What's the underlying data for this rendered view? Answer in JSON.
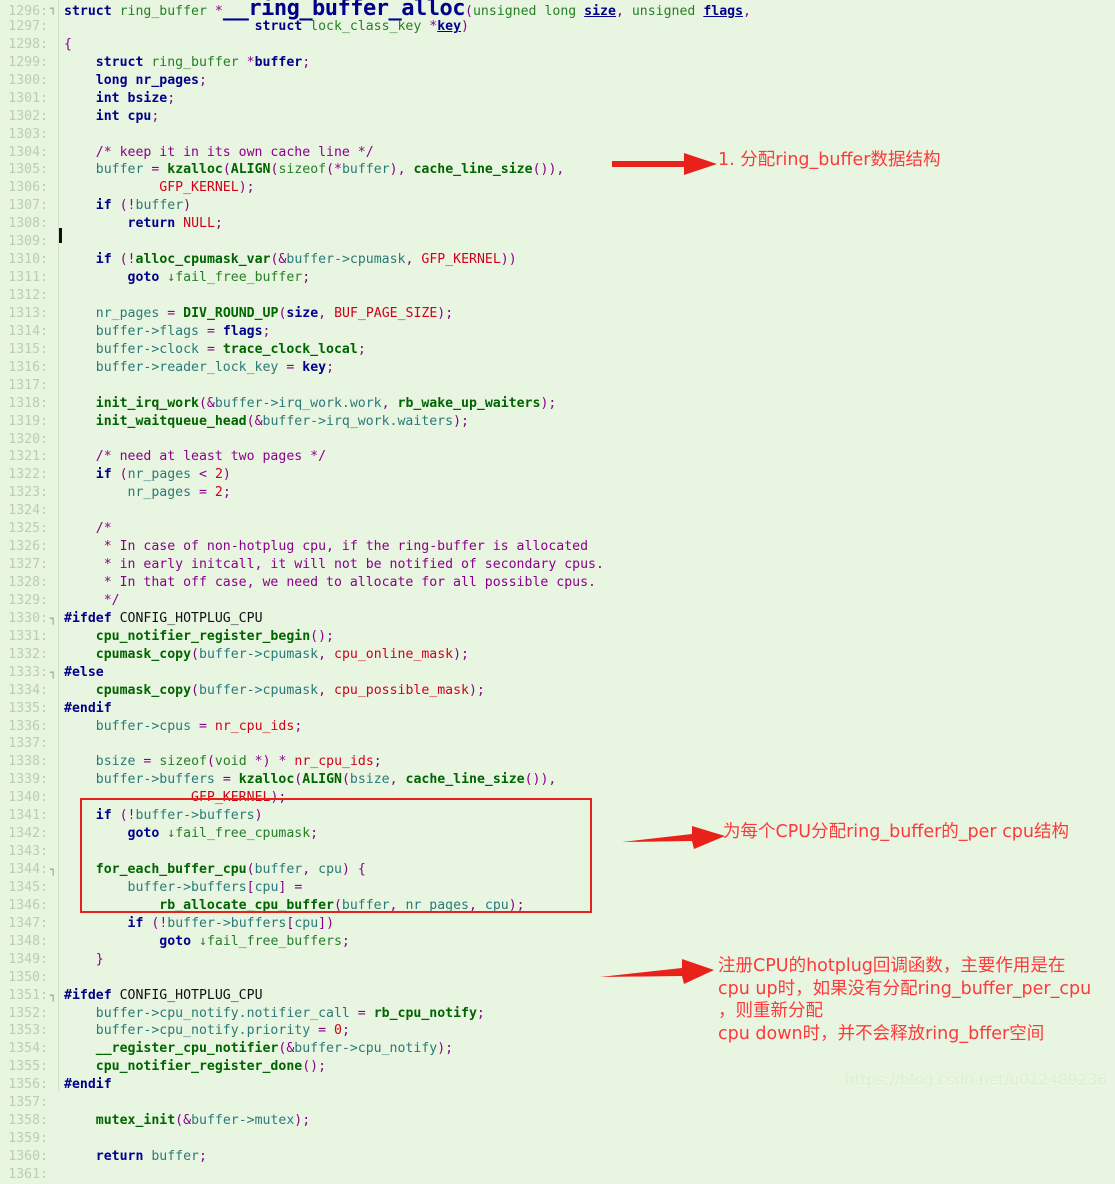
{
  "editor": {
    "background_color": "#e8f5e0",
    "gutter_color": "#b9cfb0",
    "first_line": 1296,
    "last_line": 1361,
    "cursor_line": 1309
  },
  "lines": [
    {
      "n": "1296",
      "fold": "-",
      "html": "<span class=\"kw\">struct</span> <span class=\"type\">ring_buffer</span> <span class=\"punc\">*</span><span class=\"big\">__ring_buffer_alloc</span><span class=\"punc\">(</span><span class=\"type\">unsigned</span> <span class=\"type\">long</span> <span class=\"varb ulin\">size</span><span class=\"punc\">,</span> <span class=\"type\">unsigned</span> <span class=\"varb ulin\">flags</span><span class=\"punc\">,</span>"
    },
    {
      "n": "1297",
      "fold": "",
      "html": "                        <span class=\"kw\">struct</span> <span class=\"type\">lock_class_key</span> <span class=\"punc\">*</span><span class=\"varb ulin\">key</span><span class=\"punc\">)</span>"
    },
    {
      "n": "1298",
      "fold": "",
      "html": "<span class=\"punc\">{</span>"
    },
    {
      "n": "1299",
      "fold": "",
      "html": "    <span class=\"kw\">struct</span> <span class=\"type\">ring_buffer</span> <span class=\"punc\">*</span><span class=\"varb\">buffer</span><span class=\"punc\">;</span>"
    },
    {
      "n": "1300",
      "fold": "",
      "html": "    <span class=\"kw\">long</span> <span class=\"varb\">nr_pages</span><span class=\"punc\">;</span>"
    },
    {
      "n": "1301",
      "fold": "",
      "html": "    <span class=\"kw\">int</span> <span class=\"varb\">bsize</span><span class=\"punc\">;</span>"
    },
    {
      "n": "1302",
      "fold": "",
      "html": "    <span class=\"kw\">int</span> <span class=\"varb\">cpu</span><span class=\"punc\">;</span>"
    },
    {
      "n": "1303",
      "fold": "",
      "html": ""
    },
    {
      "n": "1304",
      "fold": "",
      "html": "    <span class=\"cmt\">/* keep it in its own cache line */</span>"
    },
    {
      "n": "1305",
      "fold": "",
      "html": "    <span class=\"var\">buffer</span> <span class=\"punc\">=</span> <span class=\"fn\">kzalloc</span><span class=\"punc\">(</span><span class=\"fn\">ALIGN</span><span class=\"punc\">(</span><span class=\"type\">sizeof</span><span class=\"punc\">(*</span><span class=\"var\">buffer</span><span class=\"punc\">),</span> <span class=\"fn\">cache_line_size</span><span class=\"punc\">()),</span>"
    },
    {
      "n": "1306",
      "fold": "",
      "html": "            <span class=\"macro\">GFP_KERNEL</span><span class=\"punc\">);</span>"
    },
    {
      "n": "1307",
      "fold": "",
      "html": "    <span class=\"kw\">if</span> <span class=\"punc\">(!</span><span class=\"var\">buffer</span><span class=\"punc\">)</span>"
    },
    {
      "n": "1308",
      "fold": "",
      "html": "        <span class=\"kw\">return</span> <span class=\"macro\">NULL</span><span class=\"punc\">;</span>"
    },
    {
      "n": "1309",
      "fold": "",
      "html": ""
    },
    {
      "n": "1310",
      "fold": "",
      "html": "    <span class=\"kw\">if</span> <span class=\"punc\">(!</span><span class=\"fn\">alloc_cpumask_var</span><span class=\"punc\">(&amp;</span><span class=\"var\">buffer-&gt;cpumask</span><span class=\"punc\">,</span> <span class=\"macro\">GFP_KERNEL</span><span class=\"punc\">))</span>"
    },
    {
      "n": "1311",
      "fold": "",
      "html": "        <span class=\"kw\">goto</span> <span class=\"type\">&#8595;fail_free_buffer</span><span class=\"punc\">;</span>"
    },
    {
      "n": "1312",
      "fold": "",
      "html": ""
    },
    {
      "n": "1313",
      "fold": "",
      "html": "    <span class=\"var\">nr_pages</span> <span class=\"punc\">=</span> <span class=\"fn\">DIV_ROUND_UP</span><span class=\"punc\">(</span><span class=\"varb\">size</span><span class=\"punc\">,</span> <span class=\"macro\">BUF_PAGE_SIZE</span><span class=\"punc\">);</span>"
    },
    {
      "n": "1314",
      "fold": "",
      "html": "    <span class=\"var\">buffer-&gt;flags</span> <span class=\"punc\">=</span> <span class=\"varb\">flags</span><span class=\"punc\">;</span>"
    },
    {
      "n": "1315",
      "fold": "",
      "html": "    <span class=\"var\">buffer-&gt;clock</span> <span class=\"punc\">=</span> <span class=\"fn\">trace_clock_local</span><span class=\"punc\">;</span>"
    },
    {
      "n": "1316",
      "fold": "",
      "html": "    <span class=\"var\">buffer-&gt;reader_lock_key</span> <span class=\"punc\">=</span> <span class=\"varb\">key</span><span class=\"punc\">;</span>"
    },
    {
      "n": "1317",
      "fold": "",
      "html": ""
    },
    {
      "n": "1318",
      "fold": "",
      "html": "    <span class=\"fn\">init_irq_work</span><span class=\"punc\">(&amp;</span><span class=\"var\">buffer-&gt;irq_work.work</span><span class=\"punc\">,</span> <span class=\"fn\">rb_wake_up_waiters</span><span class=\"punc\">);</span>"
    },
    {
      "n": "1319",
      "fold": "",
      "html": "    <span class=\"fn\">init_waitqueue_head</span><span class=\"punc\">(&amp;</span><span class=\"var\">buffer-&gt;irq_work.waiters</span><span class=\"punc\">);</span>"
    },
    {
      "n": "1320",
      "fold": "",
      "html": ""
    },
    {
      "n": "1321",
      "fold": "",
      "html": "    <span class=\"cmt\">/* need at least two pages */</span>"
    },
    {
      "n": "1322",
      "fold": "",
      "html": "    <span class=\"kw\">if</span> <span class=\"punc\">(</span><span class=\"var\">nr_pages</span> <span class=\"punc\">&lt;</span> <span class=\"num\">2</span><span class=\"punc\">)</span>"
    },
    {
      "n": "1323",
      "fold": "",
      "html": "        <span class=\"var\">nr_pages</span> <span class=\"punc\">=</span> <span class=\"num\">2</span><span class=\"punc\">;</span>"
    },
    {
      "n": "1324",
      "fold": "",
      "html": ""
    },
    {
      "n": "1325",
      "fold": "",
      "html": "    <span class=\"cmt\">/*</span>"
    },
    {
      "n": "1326",
      "fold": "",
      "html": "     <span class=\"cmt\">* In case of non-hotplug cpu, if the ring-buffer is allocated</span>"
    },
    {
      "n": "1327",
      "fold": "",
      "html": "     <span class=\"cmt\">* in early initcall, it will not be notified of secondary cpus.</span>"
    },
    {
      "n": "1328",
      "fold": "",
      "html": "     <span class=\"cmt\">* In that off case, we need to allocate for all possible cpus.</span>"
    },
    {
      "n": "1329",
      "fold": "",
      "html": "     <span class=\"cmt\">*/</span>"
    },
    {
      "n": "1330",
      "fold": "-",
      "html": "<span class=\"pre\">#ifdef</span> <span class=\"preid\">CONFIG_HOTPLUG_CPU</span>"
    },
    {
      "n": "1331",
      "fold": "",
      "html": "    <span class=\"fn\">cpu_notifier_register_begin</span><span class=\"punc\">();</span>"
    },
    {
      "n": "1332",
      "fold": "",
      "html": "    <span class=\"fn\">cpumask_copy</span><span class=\"punc\">(</span><span class=\"var\">buffer-&gt;cpumask</span><span class=\"punc\">,</span> <span class=\"macro\">cpu_online_mask</span><span class=\"punc\">);</span>"
    },
    {
      "n": "1333",
      "fold": "-",
      "html": "<span class=\"pre\">#else</span>"
    },
    {
      "n": "1334",
      "fold": "",
      "html": "    <span class=\"fn\">cpumask_copy</span><span class=\"punc\">(</span><span class=\"var\">buffer-&gt;cpumask</span><span class=\"punc\">,</span> <span class=\"macro\">cpu_possible_mask</span><span class=\"punc\">);</span>"
    },
    {
      "n": "1335",
      "fold": "",
      "html": "<span class=\"pre\">#endif</span>"
    },
    {
      "n": "1336",
      "fold": "",
      "html": "    <span class=\"var\">buffer-&gt;cpus</span> <span class=\"punc\">=</span> <span class=\"macro\">nr_cpu_ids</span><span class=\"punc\">;</span>"
    },
    {
      "n": "1337",
      "fold": "",
      "html": ""
    },
    {
      "n": "1338",
      "fold": "",
      "html": "    <span class=\"var\">bsize</span> <span class=\"punc\">=</span> <span class=\"type\">sizeof</span><span class=\"punc\">(</span><span class=\"type\">void</span> <span class=\"punc\">*)</span> <span class=\"punc\">*</span> <span class=\"macro\">nr_cpu_ids</span><span class=\"punc\">;</span>"
    },
    {
      "n": "1339",
      "fold": "",
      "html": "    <span class=\"var\">buffer-&gt;buffers</span> <span class=\"punc\">=</span> <span class=\"fn\">kzalloc</span><span class=\"punc\">(</span><span class=\"fn\">ALIGN</span><span class=\"punc\">(</span><span class=\"var\">bsize</span><span class=\"punc\">,</span> <span class=\"fn\">cache_line_size</span><span class=\"punc\">()),</span>"
    },
    {
      "n": "1340",
      "fold": "",
      "html": "                <span class=\"macro\">GFP_KERNEL</span><span class=\"punc\">);</span>"
    },
    {
      "n": "1341",
      "fold": "",
      "html": "    <span class=\"kw\">if</span> <span class=\"punc\">(!</span><span class=\"var\">buffer-&gt;buffers</span><span class=\"punc\">)</span>"
    },
    {
      "n": "1342",
      "fold": "",
      "html": "        <span class=\"kw\">goto</span> <span class=\"type\">&#8595;fail_free_cpumask</span><span class=\"punc\">;</span>"
    },
    {
      "n": "1343",
      "fold": "",
      "html": ""
    },
    {
      "n": "1344",
      "fold": "-",
      "html": "    <span class=\"fn\">for_each_buffer_cpu</span><span class=\"punc\">(</span><span class=\"var\">buffer</span><span class=\"punc\">,</span> <span class=\"var\">cpu</span><span class=\"punc\">)</span> <span class=\"punc\">{</span>"
    },
    {
      "n": "1345",
      "fold": "",
      "html": "        <span class=\"var\">buffer-&gt;buffers</span><span class=\"punc\">[</span><span class=\"var\">cpu</span><span class=\"punc\">]</span> <span class=\"punc\">=</span>"
    },
    {
      "n": "1346",
      "fold": "",
      "html": "            <span class=\"fn\">rb_allocate_cpu_buffer</span><span class=\"punc\">(</span><span class=\"var\">buffer</span><span class=\"punc\">,</span> <span class=\"var\">nr_pages</span><span class=\"punc\">,</span> <span class=\"var\">cpu</span><span class=\"punc\">);</span>"
    },
    {
      "n": "1347",
      "fold": "",
      "html": "        <span class=\"kw\">if</span> <span class=\"punc\">(!</span><span class=\"var\">buffer-&gt;buffers</span><span class=\"punc\">[</span><span class=\"var\">cpu</span><span class=\"punc\">])</span>"
    },
    {
      "n": "1348",
      "fold": "",
      "html": "            <span class=\"kw\">goto</span> <span class=\"type\">&#8595;fail_free_buffers</span><span class=\"punc\">;</span>"
    },
    {
      "n": "1349",
      "fold": "",
      "html": "    <span class=\"punc\">}</span>"
    },
    {
      "n": "1350",
      "fold": "",
      "html": ""
    },
    {
      "n": "1351",
      "fold": "-",
      "html": "<span class=\"pre\">#ifdef</span> <span class=\"preid\">CONFIG_HOTPLUG_CPU</span>"
    },
    {
      "n": "1352",
      "fold": "",
      "html": "    <span class=\"var\">buffer-&gt;cpu_notify.notifier_call</span> <span class=\"punc\">=</span> <span class=\"fn\">rb_cpu_notify</span><span class=\"punc\">;</span>"
    },
    {
      "n": "1353",
      "fold": "",
      "html": "    <span class=\"var\">buffer-&gt;cpu_notify.priority</span> <span class=\"punc\">=</span> <span class=\"num\">0</span><span class=\"punc\">;</span>"
    },
    {
      "n": "1354",
      "fold": "",
      "html": "    <span class=\"fn\">__register_cpu_notifier</span><span class=\"punc\">(&amp;</span><span class=\"var\">buffer-&gt;cpu_notify</span><span class=\"punc\">);</span>"
    },
    {
      "n": "1355",
      "fold": "",
      "html": "    <span class=\"fn\">cpu_notifier_register_done</span><span class=\"punc\">();</span>"
    },
    {
      "n": "1356",
      "fold": "",
      "html": "<span class=\"pre\">#endif</span>"
    },
    {
      "n": "1357",
      "fold": "",
      "html": ""
    },
    {
      "n": "1358",
      "fold": "",
      "html": "    <span class=\"fn\">mutex_init</span><span class=\"punc\">(&amp;</span><span class=\"var\">buffer-&gt;mutex</span><span class=\"punc\">);</span>"
    },
    {
      "n": "1359",
      "fold": "",
      "html": ""
    },
    {
      "n": "1360",
      "fold": "",
      "html": "    <span class=\"kw\">return</span> <span class=\"var\">buffer</span><span class=\"punc\">;</span>"
    },
    {
      "n": "1361",
      "fold": "",
      "html": ""
    }
  ],
  "code_plaintext": [
    "struct ring_buffer *__ring_buffer_alloc(unsigned long size, unsigned flags,",
    "                        struct lock_class_key *key)",
    "{",
    "    struct ring_buffer *buffer;",
    "    long nr_pages;",
    "    int bsize;",
    "    int cpu;",
    "",
    "    /* keep it in its own cache line */",
    "    buffer = kzalloc(ALIGN(sizeof(*buffer), cache_line_size()),",
    "            GFP_KERNEL);",
    "    if (!buffer)",
    "        return NULL;",
    "",
    "    if (!alloc_cpumask_var(&buffer->cpumask, GFP_KERNEL))",
    "        goto fail_free_buffer;",
    "",
    "    nr_pages = DIV_ROUND_UP(size, BUF_PAGE_SIZE);",
    "    buffer->flags = flags;",
    "    buffer->clock = trace_clock_local;",
    "    buffer->reader_lock_key = key;",
    "",
    "    init_irq_work(&buffer->irq_work.work, rb_wake_up_waiters);",
    "    init_waitqueue_head(&buffer->irq_work.waiters);",
    "",
    "    /* need at least two pages */",
    "    if (nr_pages < 2)",
    "        nr_pages = 2;",
    "",
    "    /*",
    "     * In case of non-hotplug cpu, if the ring-buffer is allocated",
    "     * in early initcall, it will not be notified of secondary cpus.",
    "     * In that off case, we need to allocate for all possible cpus.",
    "     */",
    "#ifdef CONFIG_HOTPLUG_CPU",
    "    cpu_notifier_register_begin();",
    "    cpumask_copy(buffer->cpumask, cpu_online_mask);",
    "#else",
    "    cpumask_copy(buffer->cpumask, cpu_possible_mask);",
    "#endif",
    "    buffer->cpus = nr_cpu_ids;",
    "",
    "    bsize = sizeof(void *) * nr_cpu_ids;",
    "    buffer->buffers = kzalloc(ALIGN(bsize, cache_line_size()),",
    "                GFP_KERNEL);",
    "    if (!buffer->buffers)",
    "        goto fail_free_cpumask;",
    "",
    "    for_each_buffer_cpu(buffer, cpu) {",
    "        buffer->buffers[cpu] =",
    "            rb_allocate_cpu_buffer(buffer, nr_pages, cpu);",
    "        if (!buffer->buffers[cpu])",
    "            goto fail_free_buffers;",
    "    }",
    "",
    "#ifdef CONFIG_HOTPLUG_CPU",
    "    buffer->cpu_notify.notifier_call = rb_cpu_notify;",
    "    buffer->cpu_notify.priority = 0;",
    "    __register_cpu_notifier(&buffer->cpu_notify);",
    "    cpu_notifier_register_done();",
    "#endif",
    "",
    "    mutex_init(&buffer->mutex);",
    "",
    "    return buffer;"
  ],
  "annotations": [
    {
      "id": "annotation-1",
      "text": "1. 分配ring_buffer数据结构",
      "color": "#fb3b3b",
      "target_line": "1305"
    },
    {
      "id": "annotation-2",
      "text": "为每个CPU分配ring_buffer的_per cpu结构",
      "color": "#fb3b3b",
      "target_line": "1344"
    },
    {
      "id": "annotation-3",
      "text": "注册CPU的hotplug回调函数，主要作用是在\ncpu up时，如果没有分配ring_buffer_per_cpu\n，则重新分配\ncpu down时，并不会释放ring_bffer空间",
      "color": "#fb3b3b",
      "target_line": "1354"
    }
  ],
  "highlight_box": {
    "color": "#e8211a",
    "lines_from": "1344",
    "lines_to": "1349"
  },
  "watermark": {
    "text": "https://blog.csdn.net/u012489236",
    "color": "#dcefd2"
  }
}
